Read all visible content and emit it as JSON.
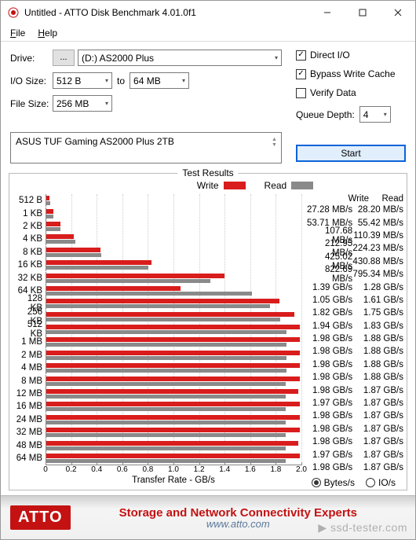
{
  "window": {
    "title": "Untitled - ATTO Disk Benchmark 4.01.0f1"
  },
  "menu": {
    "file": "File",
    "help": "Help"
  },
  "labels": {
    "drive": "Drive:",
    "iosize": "I/O Size:",
    "filesize": "File Size:",
    "to": "to",
    "queue_depth": "Queue Depth:",
    "test_results": "Test Results",
    "write": "Write",
    "read": "Read",
    "xaxis": "Transfer Rate - GB/s",
    "bytes_per_s": "Bytes/s",
    "io_per_s": "IO/s"
  },
  "controls": {
    "browse": "...",
    "drive": "(D:) AS2000 Plus",
    "io_from": "512 B",
    "io_to": "64 MB",
    "file_size": "256 MB",
    "direct_io": {
      "label": "Direct I/O",
      "checked": true
    },
    "bypass_cache": {
      "label": "Bypass Write Cache",
      "checked": true
    },
    "verify": {
      "label": "Verify Data",
      "checked": false
    },
    "queue_depth": "4",
    "description": "ASUS TUF Gaming AS2000 Plus 2TB",
    "start": "Start"
  },
  "footer": {
    "logo": "ATTO",
    "line1": "Storage and Network Connectivity Experts",
    "line2": "www.atto.com",
    "watermark": "▶ ssd-tester.com"
  },
  "chart_data": {
    "type": "bar",
    "title": "Test Results",
    "xlabel": "Transfer Rate - GB/s",
    "xlim": [
      0,
      2.0
    ],
    "xticks": [
      0,
      0.2,
      0.4,
      0.6,
      0.8,
      1.0,
      1.2,
      1.4,
      1.6,
      1.8,
      2.0
    ],
    "categories": [
      "512 B",
      "1 KB",
      "2 KB",
      "4 KB",
      "8 KB",
      "16 KB",
      "32 KB",
      "64 KB",
      "128 KB",
      "256 KB",
      "512 KB",
      "1 MB",
      "2 MB",
      "4 MB",
      "8 MB",
      "12 MB",
      "16 MB",
      "24 MB",
      "32 MB",
      "48 MB",
      "64 MB"
    ],
    "series": [
      {
        "name": "Write",
        "values_gbps": [
          0.02728,
          0.05371,
          0.10768,
          0.21295,
          0.42502,
          0.82269,
          1.39,
          1.05,
          1.82,
          1.94,
          1.98,
          1.98,
          1.98,
          1.98,
          1.98,
          1.97,
          1.98,
          1.98,
          1.98,
          1.97,
          1.98
        ],
        "display": [
          "27.28 MB/s",
          "53.71 MB/s",
          "107.68 MB/s",
          "212.95 MB/s",
          "425.02 MB/s",
          "822.69 MB/s",
          "1.39 GB/s",
          "1.05 GB/s",
          "1.82 GB/s",
          "1.94 GB/s",
          "1.98 GB/s",
          "1.98 GB/s",
          "1.98 GB/s",
          "1.98 GB/s",
          "1.98 GB/s",
          "1.97 GB/s",
          "1.98 GB/s",
          "1.98 GB/s",
          "1.98 GB/s",
          "1.97 GB/s",
          "1.98 GB/s"
        ]
      },
      {
        "name": "Read",
        "values_gbps": [
          0.0282,
          0.05542,
          0.11039,
          0.22423,
          0.43088,
          0.79534,
          1.28,
          1.61,
          1.75,
          1.83,
          1.88,
          1.88,
          1.88,
          1.88,
          1.87,
          1.87,
          1.87,
          1.87,
          1.87,
          1.87,
          1.87
        ],
        "display": [
          "28.20 MB/s",
          "55.42 MB/s",
          "110.39 MB/s",
          "224.23 MB/s",
          "430.88 MB/s",
          "795.34 MB/s",
          "1.28 GB/s",
          "1.61 GB/s",
          "1.75 GB/s",
          "1.83 GB/s",
          "1.88 GB/s",
          "1.88 GB/s",
          "1.88 GB/s",
          "1.88 GB/s",
          "1.87 GB/s",
          "1.87 GB/s",
          "1.87 GB/s",
          "1.87 GB/s",
          "1.87 GB/s",
          "1.87 GB/s",
          "1.87 GB/s"
        ]
      }
    ]
  }
}
